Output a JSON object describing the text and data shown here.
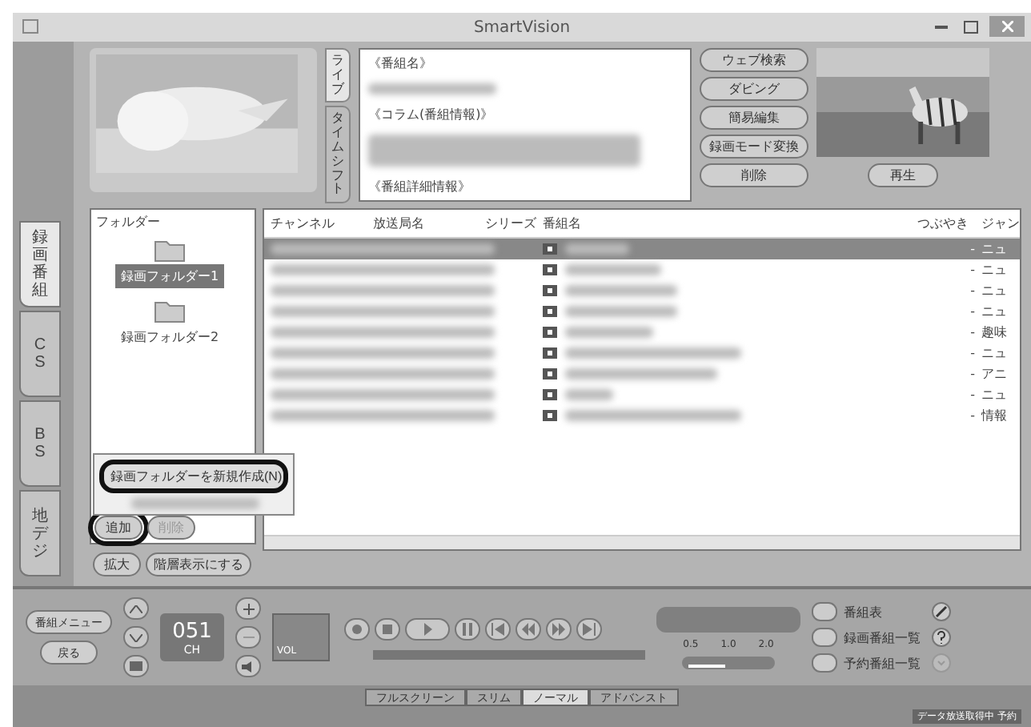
{
  "window": {
    "title": "SmartVision"
  },
  "side_tabs": [
    {
      "label": "録画番組",
      "selected": true
    },
    {
      "label": "CS",
      "selected": false
    },
    {
      "label": "BS",
      "selected": false
    },
    {
      "label": "地デジ",
      "selected": false
    }
  ],
  "preview_tabs": [
    {
      "label": "ライブ",
      "selected": true
    },
    {
      "label": "タイムシフト",
      "selected": false
    }
  ],
  "info": {
    "headings": [
      "《番組名》",
      "《コラム(番組情報)》",
      "《番組詳細情報》"
    ]
  },
  "actions": [
    "ウェブ検索",
    "ダビング",
    "簡易編集",
    "録画モード変換",
    "削除"
  ],
  "play_button": "再生",
  "folders": {
    "title": "フォルダー",
    "items": [
      {
        "label": "録画フォルダー1",
        "selected": true
      },
      {
        "label": "録画フォルダー2",
        "selected": false
      }
    ]
  },
  "context_menu": {
    "items": [
      {
        "label": "録画フォルダーを新規作成(N)",
        "highlighted": true
      }
    ]
  },
  "folder_buttons": [
    {
      "label": "追加",
      "disabled": false,
      "highlighted": true
    },
    {
      "label": "削除",
      "disabled": true,
      "highlighted": false
    }
  ],
  "view_buttons": [
    "拡大",
    "階層表示にする"
  ],
  "table": {
    "columns": [
      "チャンネル",
      "放送局名",
      "シリーズ",
      "番組名",
      "つぶやき",
      "ジャン"
    ],
    "rows": [
      {
        "selected": true,
        "tweet": "-",
        "genre": "ニュ"
      },
      {
        "selected": false,
        "tweet": "-",
        "genre": "ニュ"
      },
      {
        "selected": false,
        "tweet": "-",
        "genre": "ニュ"
      },
      {
        "selected": false,
        "tweet": "-",
        "genre": "ニュ"
      },
      {
        "selected": false,
        "tweet": "-",
        "genre": "趣味"
      },
      {
        "selected": false,
        "tweet": "-",
        "genre": "ニュ"
      },
      {
        "selected": false,
        "tweet": "-",
        "genre": "アニ"
      },
      {
        "selected": false,
        "tweet": "-",
        "genre": "ニュ"
      },
      {
        "selected": false,
        "tweet": "-",
        "genre": "情報"
      }
    ]
  },
  "player": {
    "menu_buttons": [
      "番組メニュー",
      "戻る"
    ],
    "channel": "051",
    "channel_label": "CH",
    "volume_label": "VOL",
    "speed_ticks": [
      "0.5",
      "1.0",
      "2.0"
    ],
    "speed": {
      "level": 0.45
    }
  },
  "guide_buttons": [
    "番組表",
    "録画番組一覧",
    "予約番組一覧"
  ],
  "view_modes": [
    {
      "label": "フルスクリーン",
      "selected": false
    },
    {
      "label": "スリム",
      "selected": false
    },
    {
      "label": "ノーマル",
      "selected": true
    },
    {
      "label": "アドバンスト",
      "selected": false
    }
  ],
  "status": "データ放送取得中 予約"
}
